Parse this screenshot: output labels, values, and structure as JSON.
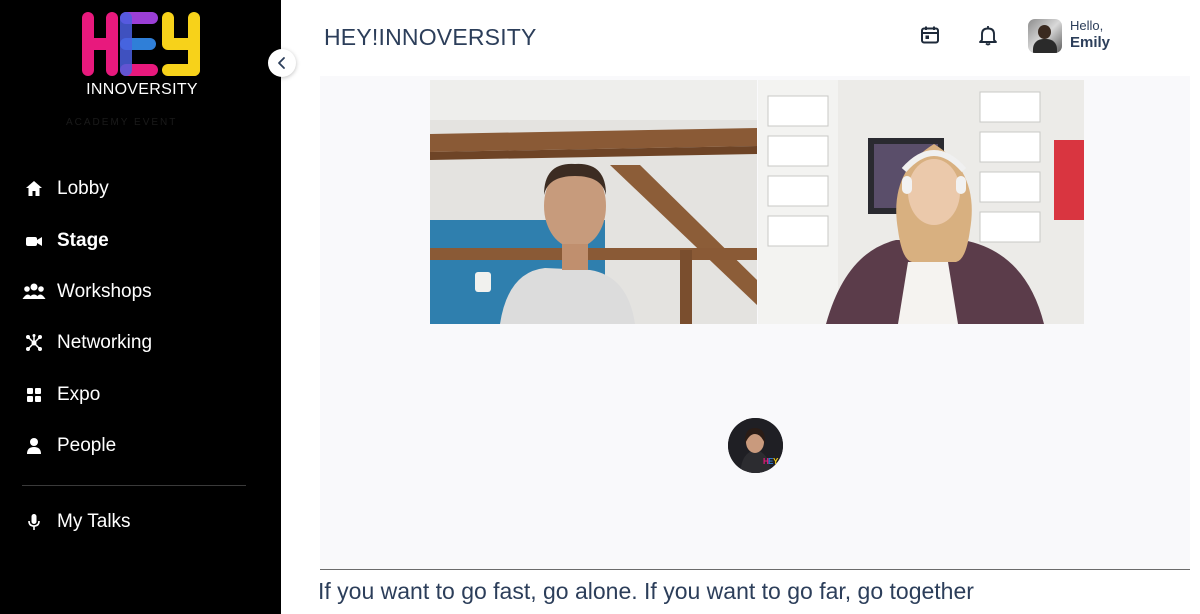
{
  "sidebar": {
    "logo_text": "INNOVERSITY",
    "logo_letters": "HEY",
    "logo_tagline": "ACADEMY EVENT",
    "items": [
      {
        "label": "Lobby",
        "icon": "home-icon"
      },
      {
        "label": "Stage",
        "icon": "camera-icon"
      },
      {
        "label": "Workshops",
        "icon": "group-icon"
      },
      {
        "label": "Networking",
        "icon": "network-icon"
      },
      {
        "label": "Expo",
        "icon": "grid-icon"
      },
      {
        "label": "People",
        "icon": "person-icon"
      },
      {
        "label": "My Talks",
        "icon": "microphone-icon"
      }
    ],
    "active_item": "Stage"
  },
  "header": {
    "title": "HEY!INNOVERSITY",
    "greeting": "Hello,",
    "user_name": "Emily"
  },
  "stage": {
    "quote": "If you want to go fast, go alone. If you want to go far, go together"
  },
  "colors": {
    "sidebar_bg": "#000000",
    "logo_pink": "#e8197d",
    "logo_blue": "#2f7fd8",
    "logo_yellow": "#f7d21a",
    "text_primary": "#2c3e5a",
    "stage_bg": "#f9f9fb"
  }
}
